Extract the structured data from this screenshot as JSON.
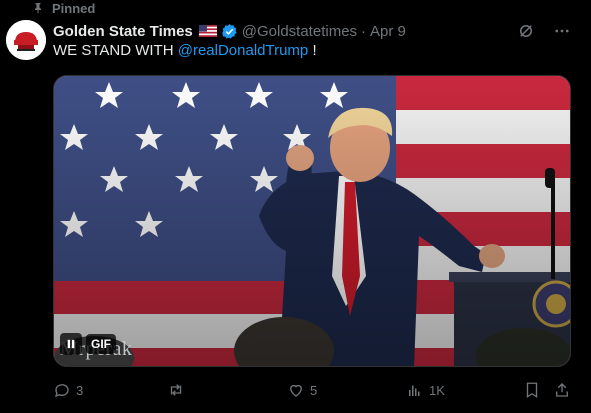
{
  "pinned": {
    "label": "Pinned"
  },
  "post": {
    "author": "Golden State Times",
    "handle": "@Goldstatetimes",
    "separator": "·",
    "date": "Apr 9",
    "text_before": "WE STAND WITH ",
    "mention": "@realDonaldTrump",
    "text_after": " !",
    "media": {
      "badge": "GIF",
      "watermark": "Mrperak"
    }
  },
  "actions": {
    "replies": "3",
    "reposts": "",
    "likes": "5",
    "views": "1K"
  },
  "colors": {
    "background": "#000000",
    "text": "#e7e9ea",
    "muted": "#71767b",
    "accent": "#1d9bf0",
    "verified": "#1d9bf0"
  },
  "icons": [
    "pin-icon",
    "flag-us-icon",
    "verified-badge-icon",
    "grok-icon",
    "more-icon",
    "pause-icon",
    "reply-icon",
    "repost-icon",
    "like-icon",
    "views-icon",
    "bookmark-icon",
    "share-icon"
  ]
}
